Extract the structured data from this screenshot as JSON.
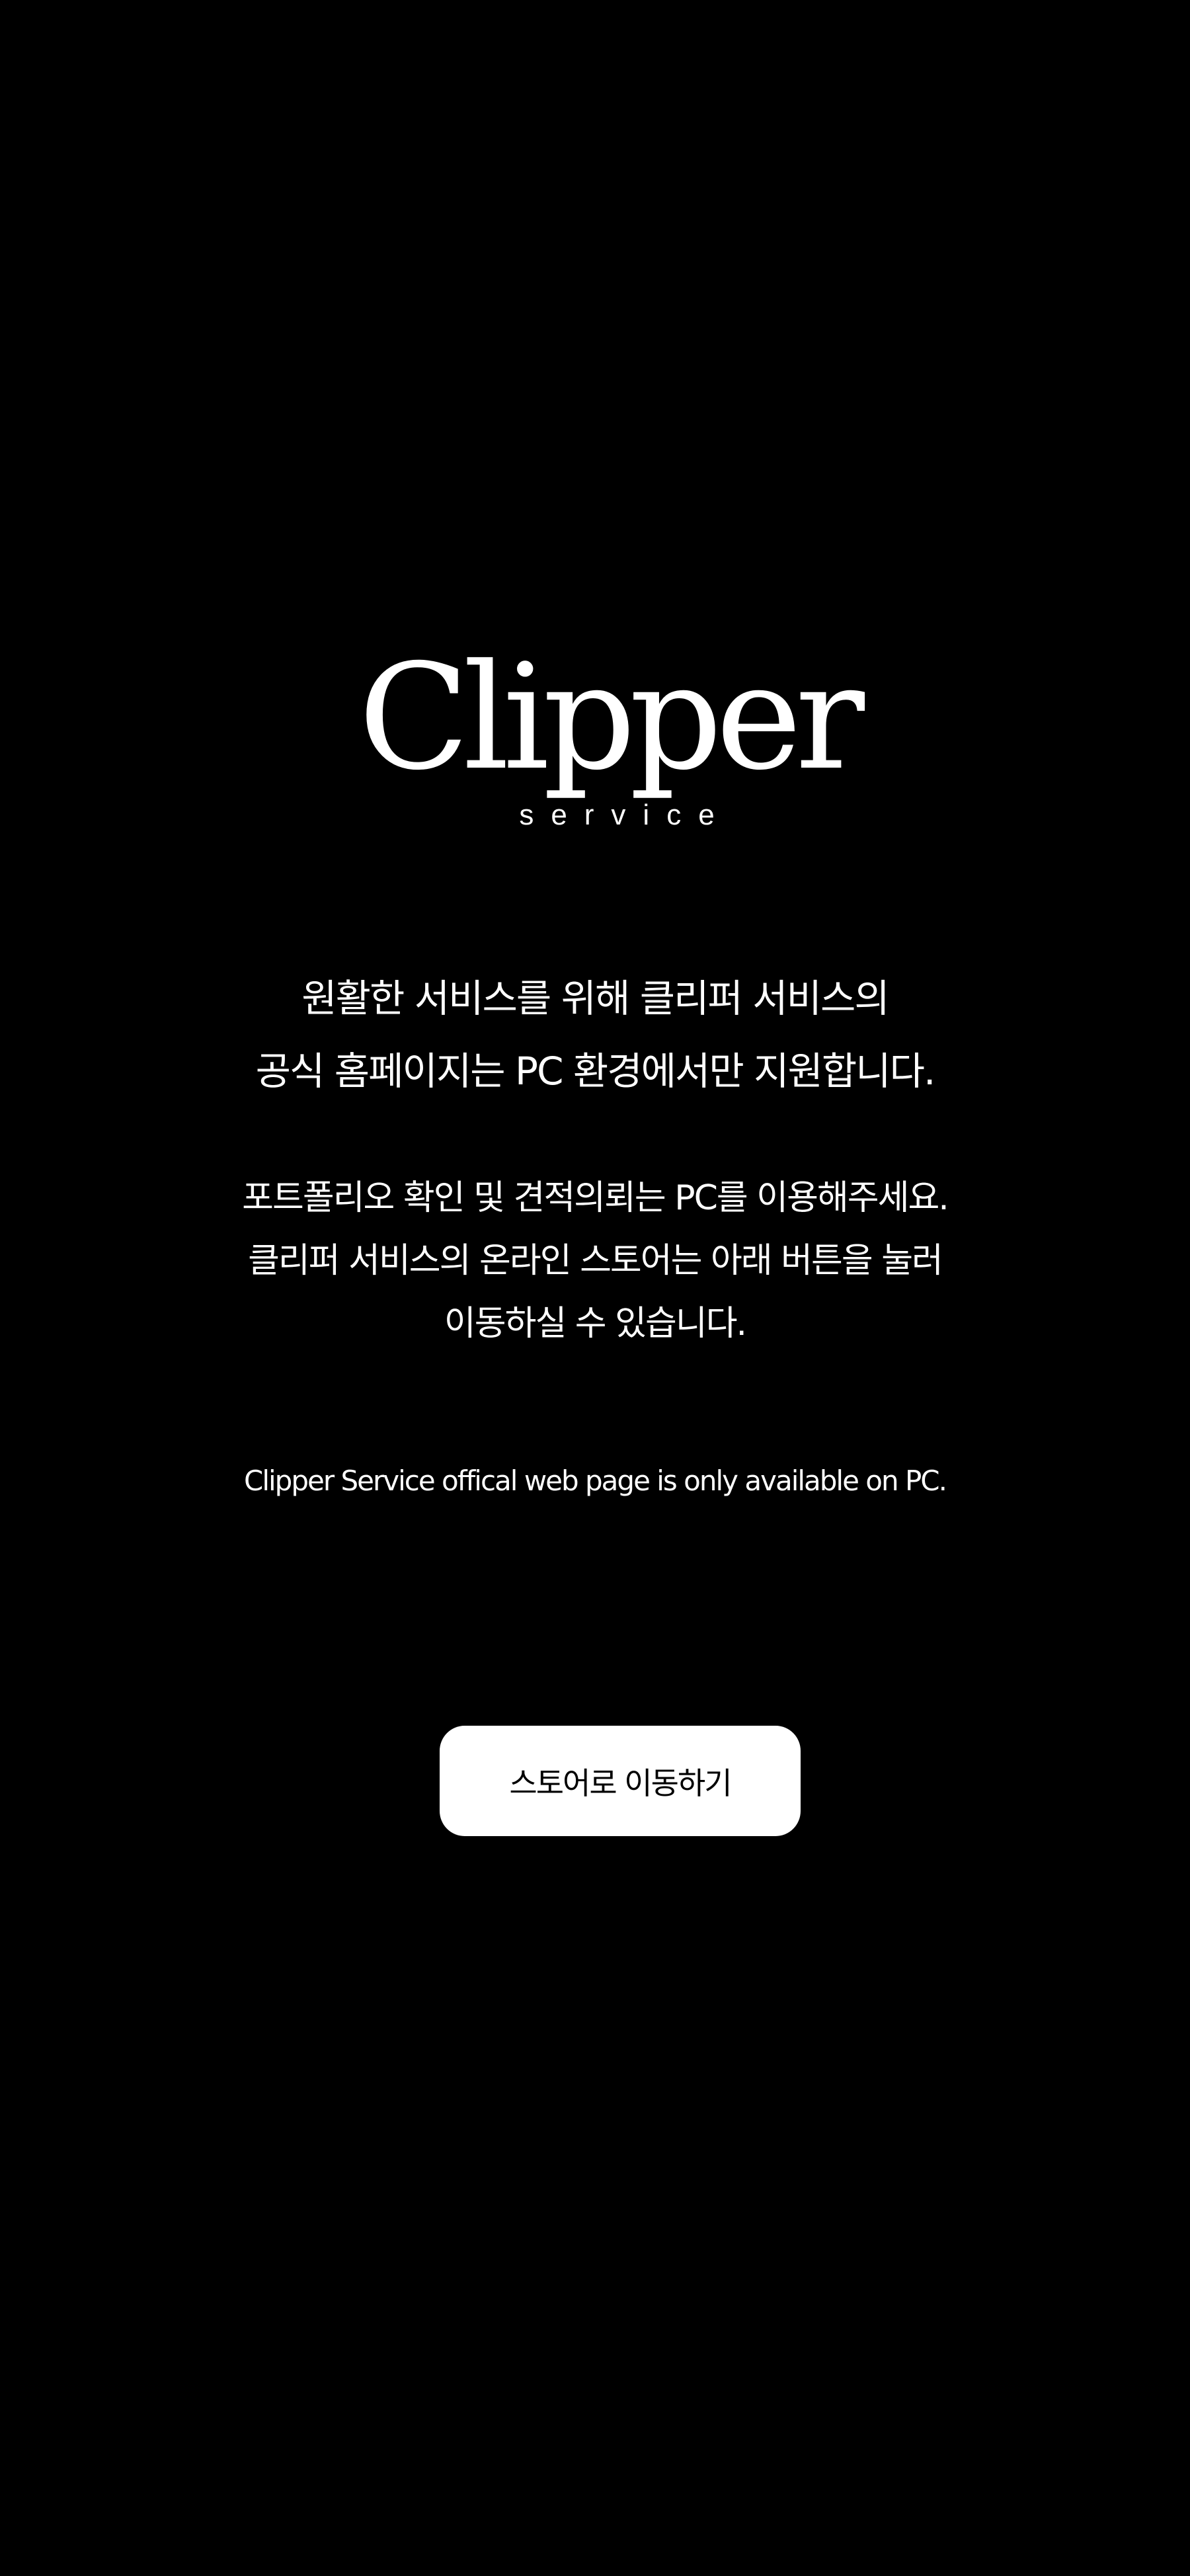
{
  "logo": {
    "wordmark": "Clipper",
    "tagline": "service"
  },
  "message": {
    "main_lines": [
      "원활한 서비스를 위해 클리퍼 서비스의",
      "공식 홈페이지는 PC 환경에서만 지원합니다."
    ],
    "sub_lines": [
      "포트폴리오 확인 및 견적의뢰는 PC를 이용해주세요.",
      "클리퍼 서비스의 온라인 스토어는 아래 버튼을 눌러",
      "이동하실 수 있습니다."
    ],
    "english": "Clipper Service offical web page is only available on  PC."
  },
  "button": {
    "label": "스토어로 이동하기"
  },
  "colors": {
    "background": "#000000",
    "text": "#ffffff",
    "button_background": "#ffffff",
    "button_text": "#000000"
  }
}
